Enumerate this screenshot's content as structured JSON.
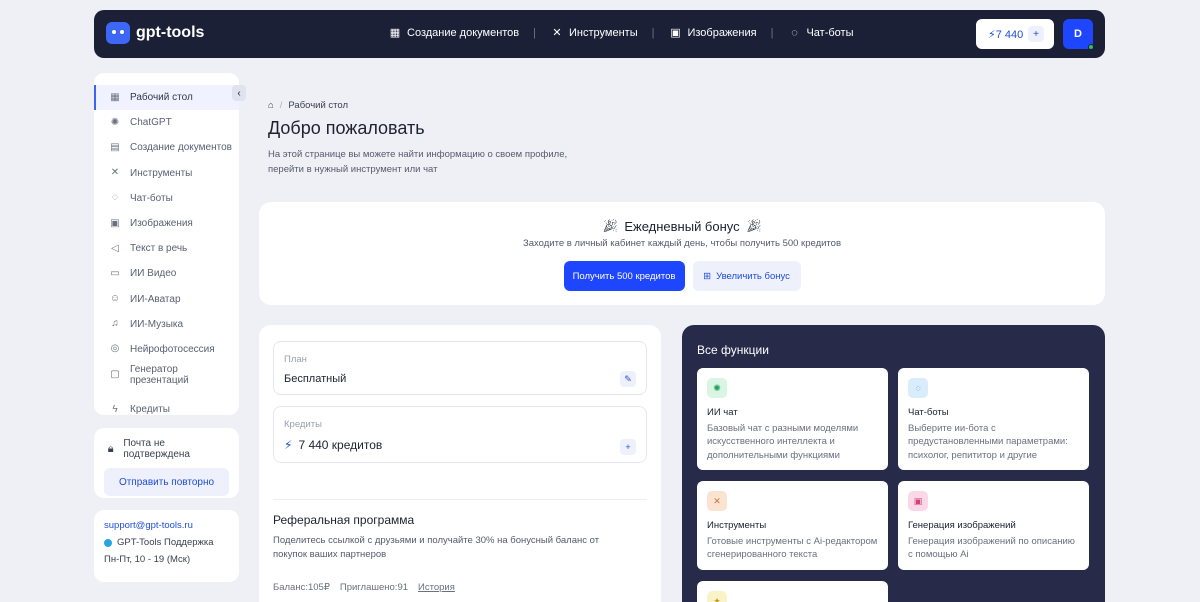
{
  "colors": {
    "accent": "#1f46ff",
    "topbar": "#1c2036",
    "panel_dark": "#272a48",
    "background": "#eef0f6"
  },
  "brand": {
    "name": "gpt-tools",
    "icon": "robot-logo-icon"
  },
  "topnav": [
    {
      "label": "Создание документов",
      "icon": "document-grid-icon"
    },
    {
      "label": "Инструменты",
      "icon": "tools-icon"
    },
    {
      "label": "Изображения",
      "icon": "image-icon"
    },
    {
      "label": "Чат-боты",
      "icon": "chat-bubbles-icon"
    }
  ],
  "header": {
    "credits": "7 440",
    "credits_icon": "lightning-icon",
    "add_label": "+",
    "avatar_initial": "D"
  },
  "sidebar": {
    "items": [
      {
        "label": "Рабочий стол",
        "icon": "dashboard-icon",
        "active": true
      },
      {
        "label": "ChatGPT",
        "icon": "openai-icon"
      },
      {
        "label": "Создание документов",
        "icon": "document-grid-icon"
      },
      {
        "label": "Инструменты",
        "icon": "tools-icon"
      },
      {
        "label": "Чат-боты",
        "icon": "chat-bubbles-icon"
      },
      {
        "label": "Изображения",
        "icon": "image-icon"
      },
      {
        "label": "Текст в речь",
        "icon": "speaker-icon"
      },
      {
        "label": "ИИ Видео",
        "icon": "video-icon"
      },
      {
        "label": "ИИ-Аватар",
        "icon": "user-icon"
      },
      {
        "label": "ИИ-Музыка",
        "icon": "music-icon"
      },
      {
        "label": "Нейрофотосессия",
        "icon": "camera-icon"
      },
      {
        "label": "Генератор презентаций",
        "icon": "presentation-icon"
      },
      {
        "label": "Кредиты",
        "icon": "lightning-icon"
      }
    ]
  },
  "email_card": {
    "status": "Почта не подтверждена",
    "button": "Отправить повторно"
  },
  "support": {
    "email": "support@gpt-tools.ru",
    "telegram": "GPT-Tools Поддержка",
    "hours": "Пн-Пт, 10 - 19 (Мск)"
  },
  "breadcrumb": {
    "current": "Рабочий стол"
  },
  "page": {
    "title": "Добро пожаловать",
    "description": "На этой странице вы можете найти информацию о своем профиле, перейти в нужный инструмент или чат"
  },
  "bonus": {
    "title": "Ежедневный бонус",
    "subtitle": "Заходите в личный кабинет каждый день, чтобы получить 500 кредитов",
    "primary_button": "Получить 500 кредитов",
    "secondary_button": "Увеличить бонус"
  },
  "profile": {
    "plan_label": "План",
    "plan_value": "Бесплатный",
    "credits_label": "Кредиты",
    "credits_value": "7 440 кредитов"
  },
  "referral": {
    "title": "Реферальная программа",
    "description": "Поделитесь ссылкой с друзьями и получайте 30% на бонусный баланс от покупок ваших партнеров",
    "balance": "Баланс:105₽",
    "invited": "Приглашено:91",
    "history": "История"
  },
  "functions": {
    "title": "Все функции",
    "cards": [
      {
        "title": "ИИ чат",
        "description": "Базовый чат с разными моделями искусственного интеллекта и дополнительными функциями",
        "icon": "ai-chat-icon",
        "color": "#d9f5e4"
      },
      {
        "title": "Чат-боты",
        "description": "Выберите ии-бота с предустановленными параметрами: психолог, репититор и другие",
        "icon": "chat-bubbles-icon",
        "color": "#d8ecfb"
      },
      {
        "title": "Инструменты",
        "description": "Готовые инструменты с Ai-редактором сгенерированного текста",
        "icon": "tools-icon",
        "color": "#fbe3d2"
      },
      {
        "title": "Генерация изображений",
        "description": "Генерация изображений по описанию с помощью Ai",
        "icon": "image-icon",
        "color": "#fbd8e6"
      },
      {
        "title": "",
        "description": "",
        "icon": "lightbulb-icon",
        "color": "#fbf3c8"
      }
    ]
  }
}
